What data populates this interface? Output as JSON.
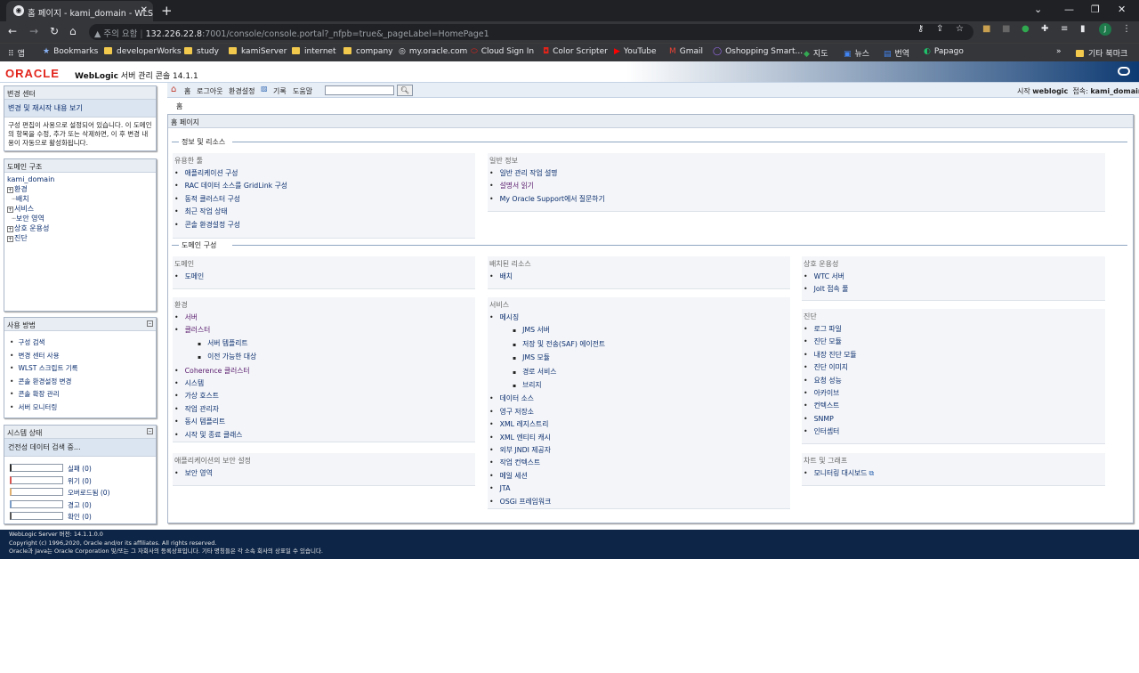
{
  "browser": {
    "tab_title": "홈 페이지 - kami_domain - WLS",
    "address_warning": "주의 요함",
    "url_host": "132.226.22.8",
    "url_rest": ":7001/console/console.portal?_nfpb=true&_pageLabel=HomePage1",
    "profile_initial": "J",
    "bookmarks": [
      "앱",
      "Bookmarks",
      "developerWorks",
      "study",
      "kamiServer",
      "internet",
      "company",
      "my.oracle.com",
      "Cloud Sign In",
      "Color Scripter",
      "YouTube",
      "Gmail",
      "Oshopping Smart...",
      "지도",
      "뉴스",
      "번역",
      "Papago"
    ],
    "other_bookmarks": "기타 북마크"
  },
  "header": {
    "brand": "ORACLE",
    "product_bold": "WebLogic",
    "product_rest": " 서버 관리 콘솔 14.1.1"
  },
  "change_center": {
    "title": "변경 센터",
    "link": "변경 및 재시작 내용 보기",
    "description": "구성 편집이 사용으로 설정되어 있습니다. 이 도메인의 항목을 수정, 추가 또는 삭제하면, 이 후 변경 내용이 자동으로 활성화됩니다."
  },
  "domain_structure": {
    "title": "도메인 구조",
    "root": "kami_domain",
    "nodes": [
      "환경",
      "배치",
      "서비스",
      "보안 영역",
      "상호 운용성",
      "진단"
    ]
  },
  "how_do_i": {
    "title": "사용 방법",
    "items": [
      "구성 검색",
      "변경 센터 사용",
      "WLST 스크립트 기록",
      "콘솔 환경설정 변경",
      "콘솔 확장 관리",
      "서버 모니터링"
    ]
  },
  "system_status": {
    "title": "시스템 상태",
    "loading": "건전성 데이터 검색 중...",
    "rows": [
      {
        "label": "실패 (0)",
        "color": "#2b2b2b"
      },
      {
        "label": "위기 (0)",
        "color": "#d9534f"
      },
      {
        "label": "오버로드됨 (0)",
        "color": "#e0b070"
      },
      {
        "label": "경고 (0)",
        "color": "#7a9cc6"
      },
      {
        "label": "확인 (0)",
        "color": "#555555"
      }
    ]
  },
  "toolbar": {
    "home": "홈",
    "logout": "로그아웃",
    "preferences": "환경설정",
    "record": "기록",
    "help": "도움말",
    "started_by": "시작",
    "user": "weblogic",
    "connected": "접속:",
    "domain": "kami_domain",
    "breadcrumb": "홈"
  },
  "main": {
    "title": "홈 페이지",
    "section_info": "정보 및 리소스",
    "useful_tools": {
      "title": "유용한 툴",
      "items": [
        "애플리케이션 구성",
        "RAC 데이터 소스를 GridLink 구성",
        "동적 클러스터 구성",
        "최근 작업 상태",
        "콘솔 환경설정 구성"
      ]
    },
    "general_info": {
      "title": "일반 정보",
      "items": [
        "일반 관리 작업 설명",
        "설명서 읽기",
        "My Oracle Support에서 질문하기"
      ]
    },
    "section_domain": "도메인 구성",
    "domain": {
      "title": "도메인",
      "items": [
        "도메인"
      ]
    },
    "environment": {
      "title": "환경",
      "items": [
        "서버",
        "클러스터",
        "서버 템플리트",
        "이전 가능한 대상",
        "Coherence 클러스터",
        "시스템",
        "가상 호스트",
        "작업 관리자",
        "동시 템플리트",
        "시작 및 종료 클래스"
      ]
    },
    "app_security": {
      "title": "애플리케이션의 보안 설정",
      "items": [
        "보안 영역"
      ]
    },
    "deployed": {
      "title": "배치된 리소스",
      "items": [
        "배치"
      ]
    },
    "services": {
      "title": "서비스",
      "items": [
        "메시징",
        "JMS 서버",
        "저장 및 전송(SAF) 에이전트",
        "JMS 모듈",
        "경로 서비스",
        "브리지",
        "데이터 소스",
        "영구 저장소",
        "XML 레지스트리",
        "XML 엔티티 캐시",
        "외부 JNDI 제공자",
        "작업 컨텍스트",
        "메일 세션",
        "JTA",
        "OSGi 프레임워크"
      ]
    },
    "interop": {
      "title": "상호 운용성",
      "items": [
        "WTC 서버",
        "Jolt 접속 풀"
      ]
    },
    "diagnostics": {
      "title": "진단",
      "items": [
        "로그 파일",
        "진단 모듈",
        "내장 진단 모듈",
        "진단 이미지",
        "요청 성능",
        "아카이브",
        "컨텍스트",
        "SNMP",
        "인터셉터"
      ]
    },
    "charts": {
      "title": "차트 및 그래프",
      "items": [
        "모니터링 대시보드"
      ]
    }
  },
  "footer": {
    "version": "WebLogic Server 버전: 14.1.1.0.0",
    "copyright": "Copyright (c) 1996,2020, Oracle and/or its affiliates. All rights reserved.",
    "trademark": "Oracle과 Java는 Oracle Corporation 및/또는 그 자회사의 등록상표입니다. 기타 명칭들은 각 소속 회사의 상표일 수 있습니다."
  }
}
